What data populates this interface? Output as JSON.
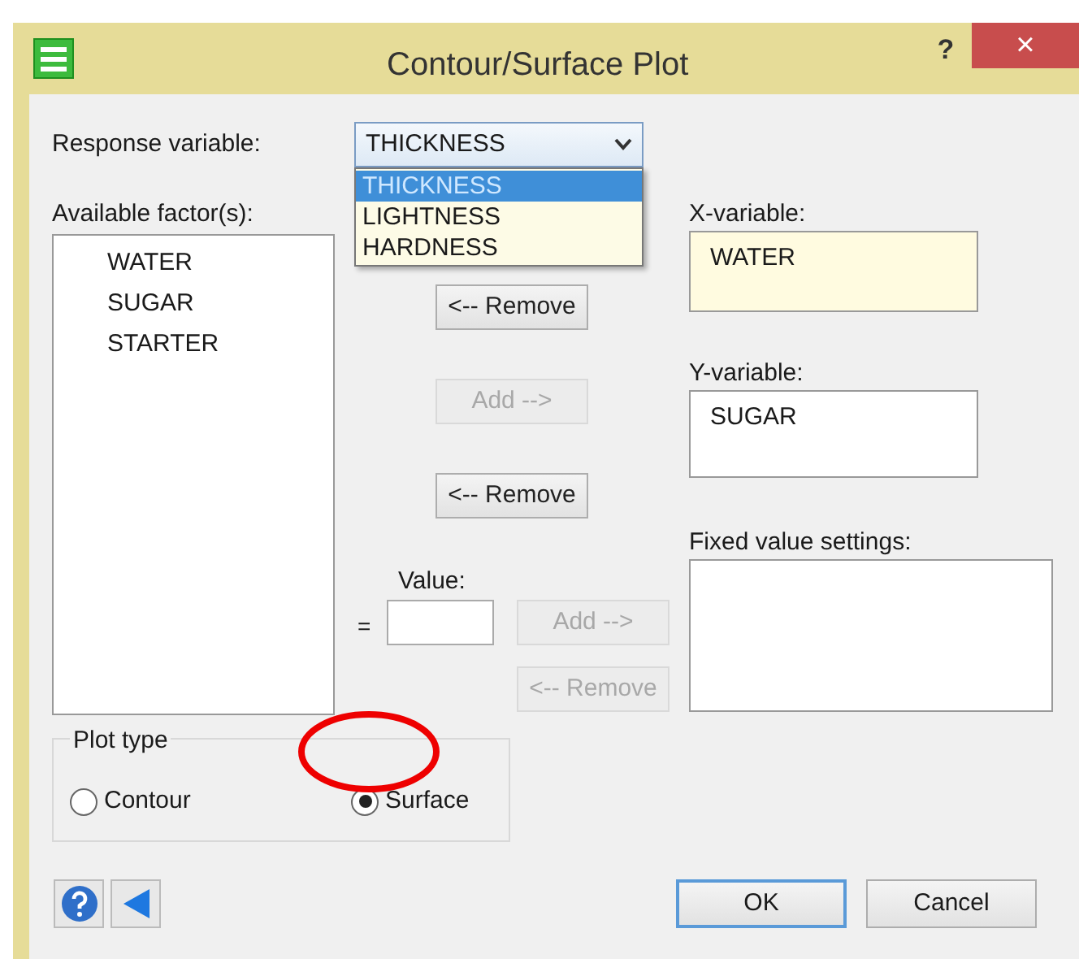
{
  "window": {
    "title": "Contour/Surface Plot",
    "help_button": "?",
    "close_button": "×"
  },
  "response_variable": {
    "label": "Response variable:",
    "value": "THICKNESS",
    "expanded": true,
    "options": [
      {
        "label": "THICKNESS",
        "selected": true
      },
      {
        "label": "LIGHTNESS",
        "selected": false
      },
      {
        "label": "HARDNESS",
        "selected": false
      }
    ]
  },
  "available_factors": {
    "label": "Available factor(s):",
    "items": [
      "WATER",
      "SUGAR",
      "STARTER"
    ]
  },
  "move_buttons": [
    {
      "label": "<-- Remove",
      "disabled": false
    },
    {
      "label": "Add -->",
      "disabled": true
    },
    {
      "label": "<-- Remove",
      "disabled": false
    }
  ],
  "x_variable": {
    "label": "X-variable:",
    "value": "WATER"
  },
  "y_variable": {
    "label": "Y-variable:",
    "value": "SUGAR"
  },
  "value": {
    "label": "Value:",
    "prefix": "=",
    "buttons": [
      {
        "label": "Add -->",
        "disabled": true
      },
      {
        "label": "<-- Remove",
        "disabled": true
      }
    ]
  },
  "fixed_value_settings": {
    "label": "Fixed value settings:"
  },
  "plot_type": {
    "label": "Plot type",
    "options": [
      {
        "label": "Contour",
        "selected": false
      },
      {
        "label": "Surface",
        "selected": true
      }
    ]
  },
  "footer_buttons": [
    {
      "label": "OK",
      "default": true
    },
    {
      "label": "Cancel",
      "default": false
    }
  ],
  "annotations": [
    {
      "kind": "ellipse"
    }
  ]
}
